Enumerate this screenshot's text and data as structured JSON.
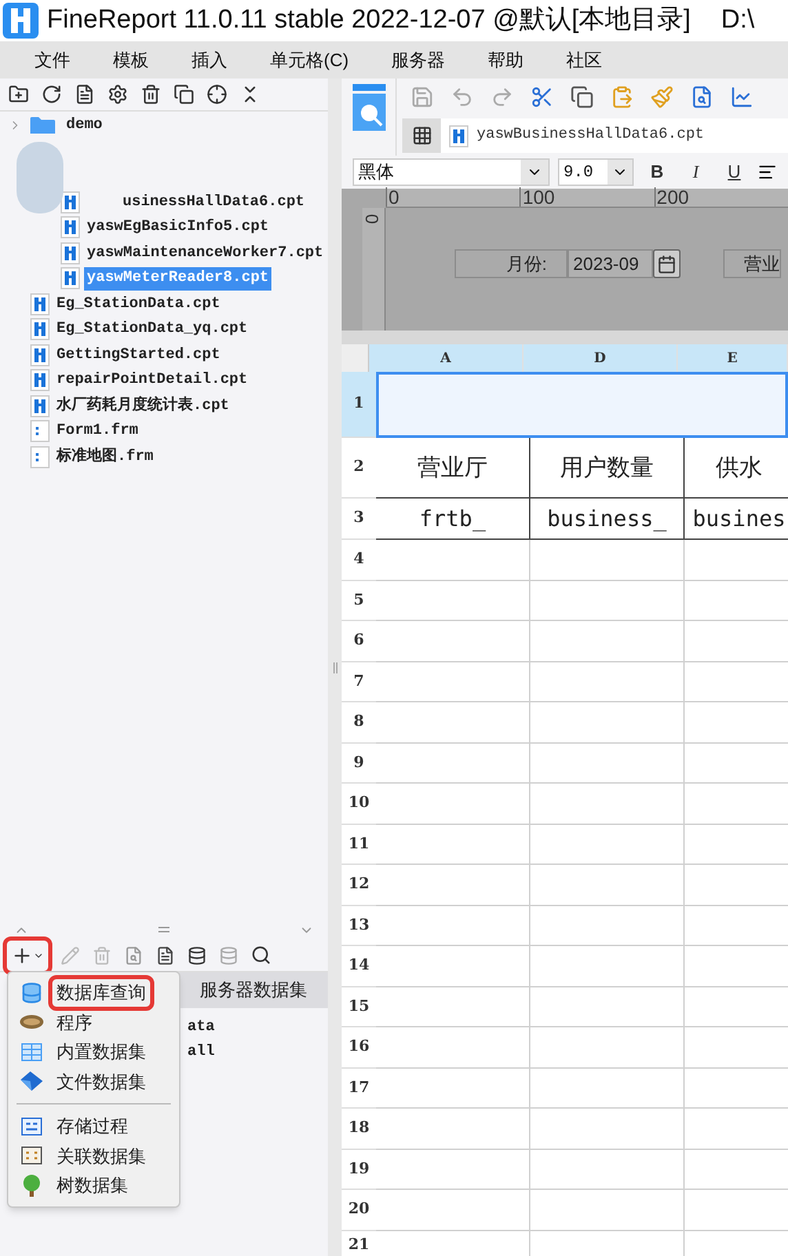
{
  "window": {
    "title": "FineReport 11.0.11 stable 2022-12-07 @默认[本地目录]",
    "path": "D:\\"
  },
  "menu": [
    "文件",
    "模板",
    "插入",
    "单元格(C)",
    "服务器",
    "帮助",
    "社区"
  ],
  "file_tree": [
    {
      "label": "demo",
      "kind": "folder",
      "expanded": false
    },
    {
      "kind": "blurred",
      "children": [
        {
          "label": "usinessHallData6.cpt",
          "kind": "cpt",
          "covered": true,
          "selected": false
        },
        {
          "label": "yaswEgBasicInfo5.cpt",
          "kind": "cpt",
          "covered": false,
          "selected": false
        },
        {
          "label": "yaswMaintenanceWorker7.cpt",
          "kind": "cpt",
          "covered": false,
          "selected": false
        },
        {
          "label": "yaswMeterReader8.cpt",
          "kind": "cpt",
          "covered": false,
          "selected": true
        }
      ]
    },
    {
      "label": "Eg_StationData.cpt",
      "kind": "cpt",
      "selected": false
    },
    {
      "label": "Eg_StationData_yq.cpt",
      "kind": "cpt",
      "selected": false
    },
    {
      "label": "GettingStarted.cpt",
      "kind": "cpt",
      "selected": false
    },
    {
      "label": "repairPointDetail.cpt",
      "kind": "cpt",
      "selected": false
    },
    {
      "label": "水厂药耗月度统计表.cpt",
      "kind": "cpt",
      "selected": false
    },
    {
      "label": "Form1.frm",
      "kind": "frm",
      "selected": false
    },
    {
      "label": "标准地图.frm",
      "kind": "frm",
      "selected": false
    }
  ],
  "report_tab": "yaswBusinessHallData6.cpt",
  "font": {
    "family": "黑体",
    "size": "9.0",
    "styles": [
      "B",
      "I",
      "U"
    ]
  },
  "parameter_pane": {
    "ruler_marks": [
      "0",
      "100",
      "200"
    ],
    "vertical_mark": "0",
    "label": "月份:",
    "value": "2023-09",
    "next_label": "营业"
  },
  "grid": {
    "columns": [
      "A",
      "D",
      "E"
    ],
    "rows": [
      {
        "number": "1",
        "selected": true,
        "cells": []
      },
      {
        "number": "2",
        "selected": false,
        "cells": [
          "营业厅",
          "用户数量",
          "供水"
        ]
      },
      {
        "number": "3",
        "selected": false,
        "cells": [
          "frtb_",
          "business_",
          "busines"
        ]
      },
      {
        "number": "4",
        "selected": false,
        "cells": []
      },
      {
        "number": "5",
        "selected": false,
        "cells": []
      },
      {
        "number": "6",
        "selected": false,
        "cells": []
      },
      {
        "number": "7",
        "selected": false,
        "cells": []
      },
      {
        "number": "8",
        "selected": false,
        "cells": []
      },
      {
        "number": "9",
        "selected": false,
        "cells": []
      },
      {
        "number": "10",
        "selected": false,
        "cells": []
      },
      {
        "number": "11",
        "selected": false,
        "cells": []
      },
      {
        "number": "12",
        "selected": false,
        "cells": []
      },
      {
        "number": "13",
        "selected": false,
        "cells": []
      },
      {
        "number": "14",
        "selected": false,
        "cells": []
      },
      {
        "number": "15",
        "selected": false,
        "cells": []
      },
      {
        "number": "16",
        "selected": false,
        "cells": []
      },
      {
        "number": "17",
        "selected": false,
        "cells": []
      },
      {
        "number": "18",
        "selected": false,
        "cells": []
      },
      {
        "number": "19",
        "selected": false,
        "cells": []
      },
      {
        "number": "20",
        "selected": false,
        "cells": []
      },
      {
        "number": "21",
        "selected": false,
        "cells": []
      }
    ]
  },
  "dataset_panel": {
    "add_button_highlighted": true,
    "tab": "服务器数据集",
    "items": [
      "ata",
      "all"
    ]
  },
  "add_menu": [
    {
      "label": "数据库查询",
      "kind": "database",
      "highlighted": true
    },
    {
      "label": "程序",
      "kind": "program",
      "highlighted": false
    },
    {
      "label": "内置数据集",
      "kind": "builtin",
      "highlighted": false
    },
    {
      "label": "文件数据集",
      "kind": "file",
      "highlighted": false
    },
    {
      "kind": "divider"
    },
    {
      "label": "存储过程",
      "kind": "procedure",
      "highlighted": false
    },
    {
      "label": "关联数据集",
      "kind": "relation",
      "highlighted": false
    },
    {
      "label": "树数据集",
      "kind": "tree",
      "highlighted": false
    }
  ]
}
